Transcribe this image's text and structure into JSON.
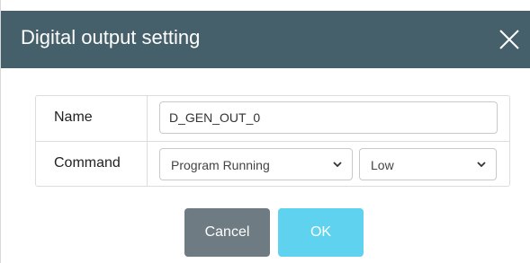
{
  "dialog": {
    "title": "Digital output setting"
  },
  "form": {
    "name": {
      "label": "Name",
      "value": "D_GEN_OUT_0"
    },
    "command": {
      "label": "Command",
      "command_selected": "Program Running",
      "level_selected": "Low"
    }
  },
  "buttons": {
    "cancel_label": "Cancel",
    "ok_label": "OK"
  },
  "colors": {
    "header_bg": "#46606b",
    "cancel_bg": "#6e7b83",
    "ok_bg": "#5fd2ef"
  },
  "icons": {
    "close": "close-icon",
    "dropdown": "chevron-down-icon"
  }
}
